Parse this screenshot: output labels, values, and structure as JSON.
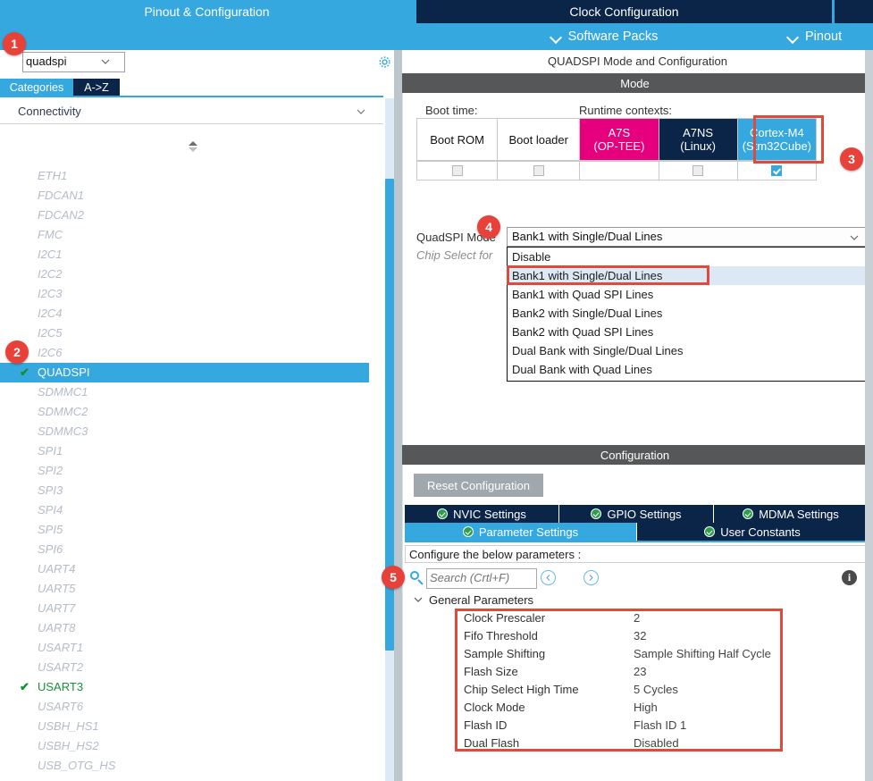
{
  "top_tabs": {
    "pinout_configuration": "Pinout & Configuration",
    "clock_configuration": "Clock Configuration"
  },
  "sub_bar": {
    "software_packs": "Software Packs",
    "pinout": "Pinout"
  },
  "left_panel": {
    "search": {
      "value": "quadspi",
      "placeholder": ""
    },
    "gear_icon": "gear-icon",
    "tabs": [
      {
        "label": "Categories",
        "active": true
      },
      {
        "label": "A->Z",
        "active": false
      }
    ],
    "group_header": "Connectivity",
    "peripherals": [
      {
        "label": "ETH1",
        "state": "disabled"
      },
      {
        "label": "FDCAN1",
        "state": "disabled"
      },
      {
        "label": "FDCAN2",
        "state": "disabled"
      },
      {
        "label": "FMC",
        "state": "disabled"
      },
      {
        "label": "I2C1",
        "state": "disabled"
      },
      {
        "label": "I2C2",
        "state": "disabled"
      },
      {
        "label": "I2C3",
        "state": "disabled"
      },
      {
        "label": "I2C4",
        "state": "disabled"
      },
      {
        "label": "I2C5",
        "state": "disabled"
      },
      {
        "label": "I2C6",
        "state": "disabled"
      },
      {
        "label": "QUADSPI",
        "state": "selected",
        "check": "✔"
      },
      {
        "label": "SDMMC1",
        "state": "disabled"
      },
      {
        "label": "SDMMC2",
        "state": "disabled"
      },
      {
        "label": "SDMMC3",
        "state": "disabled"
      },
      {
        "label": "SPI1",
        "state": "disabled"
      },
      {
        "label": "SPI2",
        "state": "disabled"
      },
      {
        "label": "SPI3",
        "state": "disabled"
      },
      {
        "label": "SPI4",
        "state": "disabled"
      },
      {
        "label": "SPI5",
        "state": "disabled"
      },
      {
        "label": "SPI6",
        "state": "disabled"
      },
      {
        "label": "UART4",
        "state": "disabled"
      },
      {
        "label": "UART5",
        "state": "disabled"
      },
      {
        "label": "UART7",
        "state": "disabled"
      },
      {
        "label": "UART8",
        "state": "disabled"
      },
      {
        "label": "USART1",
        "state": "disabled"
      },
      {
        "label": "USART2",
        "state": "disabled"
      },
      {
        "label": "USART3",
        "state": "enabled",
        "check": "✔"
      },
      {
        "label": "USART6",
        "state": "disabled"
      },
      {
        "label": "USBH_HS1",
        "state": "disabled"
      },
      {
        "label": "USBH_HS2",
        "state": "disabled"
      },
      {
        "label": "USB_OTG_HS",
        "state": "disabled"
      }
    ]
  },
  "right_panel": {
    "mode_header": "QUADSPI Mode and Configuration",
    "mode_bar": "Mode",
    "boot_time_label": "Boot time:",
    "runtime_contexts_label": "Runtime contexts:",
    "context_columns": [
      {
        "name": "Boot ROM",
        "sub": "",
        "checkbox": "unchecked"
      },
      {
        "name": "Boot loader",
        "sub": "",
        "checkbox": "unchecked"
      },
      {
        "name": "A7S",
        "sub": "(OP-TEE)",
        "checkbox": "none"
      },
      {
        "name": "A7NS",
        "sub": "(Linux)",
        "checkbox": "unchecked"
      },
      {
        "name": "Cortex-M4",
        "sub": "(Stm32Cube)",
        "checkbox": "checked"
      }
    ],
    "quadspi_mode_label": "QuadSPI Mode",
    "quadspi_mode_value": "Bank1 with Single/Dual Lines",
    "chip_select_label": "Chip Select for",
    "dropdown_options": [
      {
        "label": "Disable",
        "highlighted": false
      },
      {
        "label": "Bank1 with Single/Dual Lines",
        "highlighted": true
      },
      {
        "label": "Bank1 with Quad SPI Lines",
        "highlighted": false
      },
      {
        "label": "Bank2 with Single/Dual Lines",
        "highlighted": false
      },
      {
        "label": "Bank2 with Quad SPI Lines",
        "highlighted": false
      },
      {
        "label": "Dual Bank with Single/Dual Lines",
        "highlighted": false
      },
      {
        "label": "Dual Bank with Quad Lines",
        "highlighted": false
      }
    ],
    "configuration_bar": "Configuration",
    "reset_button": "Reset Configuration",
    "tabs_row1": [
      {
        "label": "NVIC Settings"
      },
      {
        "label": "GPIO Settings"
      },
      {
        "label": "MDMA Settings"
      }
    ],
    "tabs_row2": [
      {
        "label": "Parameter Settings",
        "active": true
      },
      {
        "label": "User Constants",
        "active": false
      }
    ],
    "configure_note": "Configure the below parameters :",
    "param_search_placeholder": "Search (Crtl+F)",
    "nav_prev_icon": "chevron-left-icon",
    "nav_next_icon": "chevron-right-icon",
    "info_icon": "info-icon",
    "group_label": "General Parameters",
    "parameters": [
      {
        "name": "Clock Prescaler",
        "value": "2"
      },
      {
        "name": "Fifo Threshold",
        "value": "32"
      },
      {
        "name": "Sample Shifting",
        "value": "Sample Shifting Half Cycle"
      },
      {
        "name": "Flash Size",
        "value": "23"
      },
      {
        "name": "Chip Select High Time",
        "value": "5 Cycles"
      },
      {
        "name": "Clock Mode",
        "value": "High"
      },
      {
        "name": "Flash ID",
        "value": "Flash ID 1"
      },
      {
        "name": "Dual Flash",
        "value": "Disabled"
      }
    ]
  },
  "badges": [
    {
      "number": "1"
    },
    {
      "number": "2"
    },
    {
      "number": "3"
    },
    {
      "number": "4"
    },
    {
      "number": "5"
    }
  ],
  "colors": {
    "accent_blue": "#35a8e0",
    "dark_navy": "#0b2549",
    "magenta": "#e6007e",
    "badge_red": "#e8413a",
    "highlight_red": "#e04a3c",
    "green_check": "#2e9e4c",
    "gray_bar": "#555759"
  }
}
